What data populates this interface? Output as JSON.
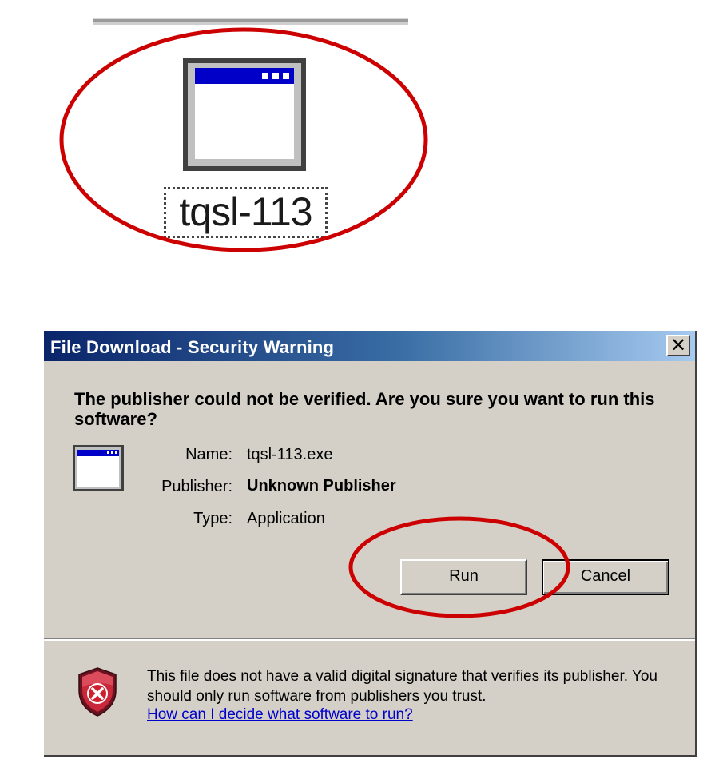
{
  "desktop_icon": {
    "label": "tqsl-113"
  },
  "dialog": {
    "title": "File Download - Security Warning",
    "close_label": "✕",
    "question": "The publisher could not be verified.  Are you sure you want to run this software?",
    "fields": [
      {
        "key": "Name:",
        "value": "tqsl-113.exe"
      },
      {
        "key": "Publisher:",
        "value": "Unknown Publisher"
      },
      {
        "key": "Type:",
        "value": "Application"
      }
    ],
    "buttons": {
      "run": "Run",
      "cancel": "Cancel"
    },
    "warning": {
      "text": "This file does not have a valid digital signature that verifies its publisher.  You should only run software from publishers you trust.",
      "link": "How can I decide what software to run?"
    }
  },
  "annotations": {
    "oval_color": "#cc0000"
  },
  "colors": {
    "titlebar_start": "#0a246a",
    "titlebar_end": "#a6caf0",
    "dialog_bg": "#d4d0c8",
    "link": "#0000cc"
  }
}
